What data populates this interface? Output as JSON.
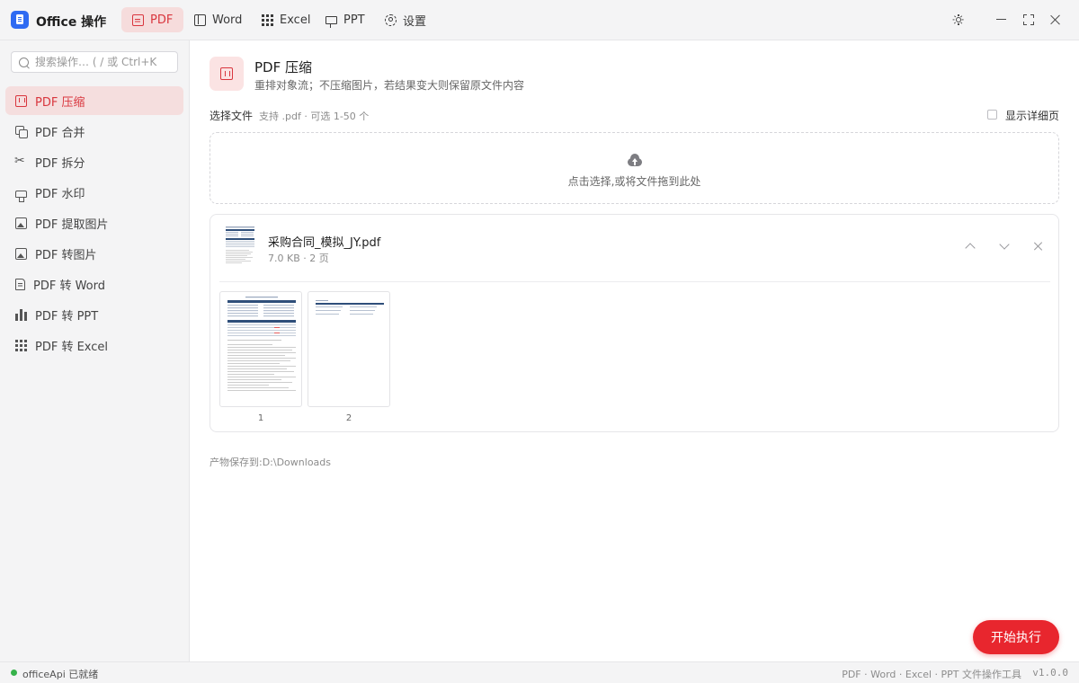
{
  "app": {
    "title": "Office 操作"
  },
  "nav": {
    "tabs": [
      {
        "label": "PDF",
        "icon": "document-icon",
        "active": true
      },
      {
        "label": "Word",
        "icon": "book-icon",
        "active": false
      },
      {
        "label": "Excel",
        "icon": "grid-icon",
        "active": false
      },
      {
        "label": "PPT",
        "icon": "presentation-icon",
        "active": false
      },
      {
        "label": "设置",
        "icon": "gear-icon",
        "active": false
      }
    ]
  },
  "window_controls": [
    "theme-toggle-icon",
    "minimize-icon",
    "maximize-icon",
    "close-icon"
  ],
  "sidebar": {
    "search_placeholder": "搜索操作… ( / 或 Ctrl+K",
    "items": [
      {
        "label": "PDF 压缩",
        "icon": "compress-icon",
        "active": true
      },
      {
        "label": "PDF 合并",
        "icon": "merge-icon",
        "active": false
      },
      {
        "label": "PDF 拆分",
        "icon": "scissors-icon",
        "active": false
      },
      {
        "label": "PDF 水印",
        "icon": "stamp-icon",
        "active": false
      },
      {
        "label": "PDF 提取图片",
        "icon": "image-icon",
        "active": false
      },
      {
        "label": "PDF 转图片",
        "icon": "image-icon",
        "active": false
      },
      {
        "label": "PDF 转 Word",
        "icon": "word-file-icon",
        "active": false
      },
      {
        "label": "PDF 转 PPT",
        "icon": "bar-chart-icon",
        "active": false
      },
      {
        "label": "PDF 转 Excel",
        "icon": "grid-icon",
        "active": false
      }
    ]
  },
  "main": {
    "title": "PDF 压缩",
    "subtitle": "重排对象流；不压缩图片，若结果变大则保留原文件内容",
    "file_section": {
      "label": "选择文件",
      "hint": "支持 .pdf · 可选 1-50 个",
      "detail_toggle_label": "显示详细页",
      "detail_toggle_checked": false
    },
    "dropzone": {
      "text": "点击选择,或将文件拖到此处",
      "icon": "cloud-upload-icon"
    },
    "file": {
      "name": "采购合同_模拟_JY.pdf",
      "meta": "7.0 KB · 2 页",
      "pages": [
        {
          "number": "1"
        },
        {
          "number": "2"
        }
      ]
    },
    "save_path": "产物保存到:D:\\Downloads",
    "run_button": "开始执行"
  },
  "status": {
    "text": "officeApi 已就绪",
    "right": "PDF · Word · Excel · PPT 文件操作工具",
    "version": "v1.0.0",
    "ready_color": "#36b24a"
  },
  "colors": {
    "accent": "#d9363e",
    "primary_button": "#e8262e"
  }
}
